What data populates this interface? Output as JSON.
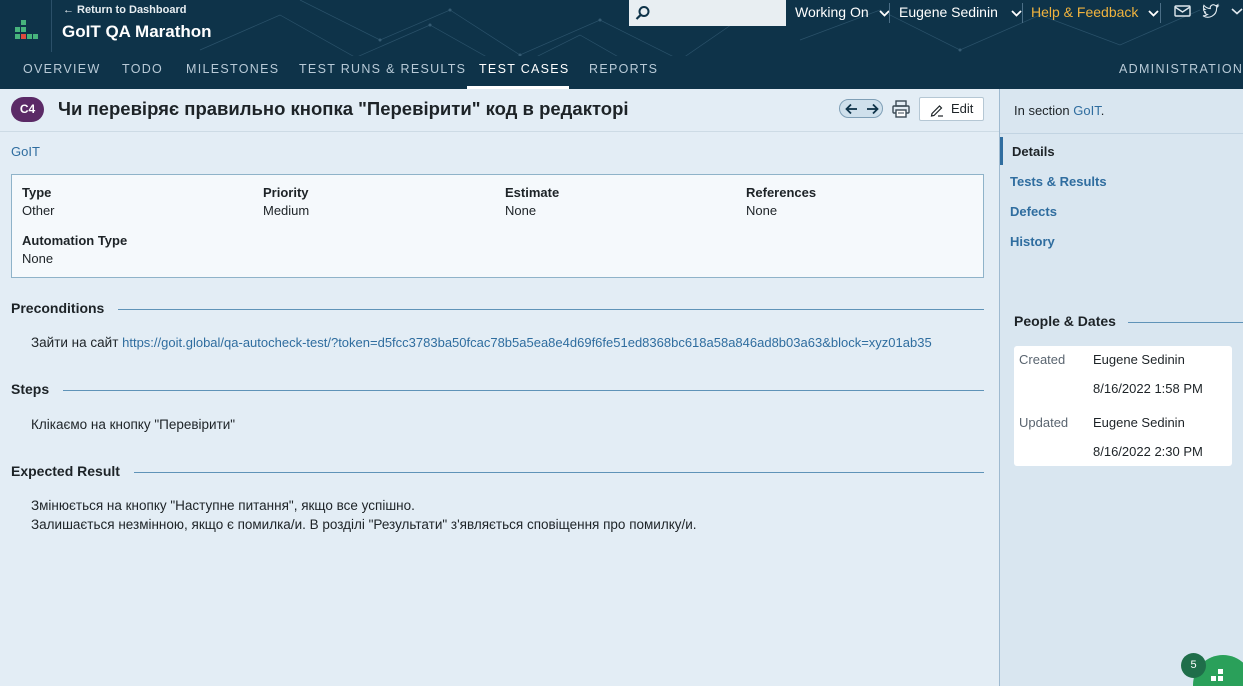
{
  "header": {
    "back_link": "← Return to Dashboard",
    "project_title": "GoIT QA Marathon",
    "search_placeholder": "",
    "working_on": "Working On",
    "user_name": "Eugene Sedinin",
    "help_feedback": "Help & Feedback",
    "icons": [
      "mail-icon",
      "twitter-icon",
      "chevron-down-icon"
    ],
    "accent_color": "#f0b33e"
  },
  "nav": {
    "tabs": [
      "OVERVIEW",
      "TODO",
      "MILESTONES",
      "TEST RUNS & RESULTS",
      "TEST CASES",
      "REPORTS"
    ],
    "active_tab": "TEST CASES",
    "admin": "ADMINISTRATION"
  },
  "case": {
    "id": "C4",
    "title": "Чи перевіряє правильно кнопка \"Перевірити\" код в редакторі",
    "edit_label": "Edit",
    "section_link": "GoIT",
    "fields": [
      {
        "label": "Type",
        "value": "Other"
      },
      {
        "label": "Priority",
        "value": "Medium"
      },
      {
        "label": "Estimate",
        "value": "None"
      },
      {
        "label": "References",
        "value": "None"
      },
      {
        "label": "Automation Type",
        "value": "None"
      }
    ],
    "preconditions": {
      "title": "Preconditions",
      "prefix": "Зайти на сайт ",
      "url": "https://goit.global/qa-autocheck-test/?token=d5fcc3783ba50fcac78b5a5ea8e4d69f6fe51ed8368bc618a58a846ad8b03a63&block=xyz01ab35"
    },
    "steps": {
      "title": "Steps",
      "text": "Клікаємо на кнопку \"Перевірити\""
    },
    "expected": {
      "title": "Expected Result",
      "lines": [
        "Змінюється на кнопку \"Наступне питання\", якщо все успішно.",
        "Залишається незмінною, якщо є помилка/и. В розділі \"Результати\" з'являється сповіщення про помилку/и."
      ]
    }
  },
  "sidebar": {
    "in_section_prefix": "In section ",
    "in_section_link": "GoIT",
    "in_section_suffix": ".",
    "nav": [
      "Details",
      "Tests & Results",
      "Defects",
      "History"
    ],
    "active_nav": "Details",
    "people_dates_title": "People & Dates",
    "created_label": "Created",
    "created_by": "Eugene Sedinin",
    "created_on": "8/16/2022 1:58 PM",
    "updated_label": "Updated",
    "updated_by": "Eugene Sedinin",
    "updated_on": "8/16/2022 2:30 PM"
  },
  "widget": {
    "badge_count": "5"
  }
}
